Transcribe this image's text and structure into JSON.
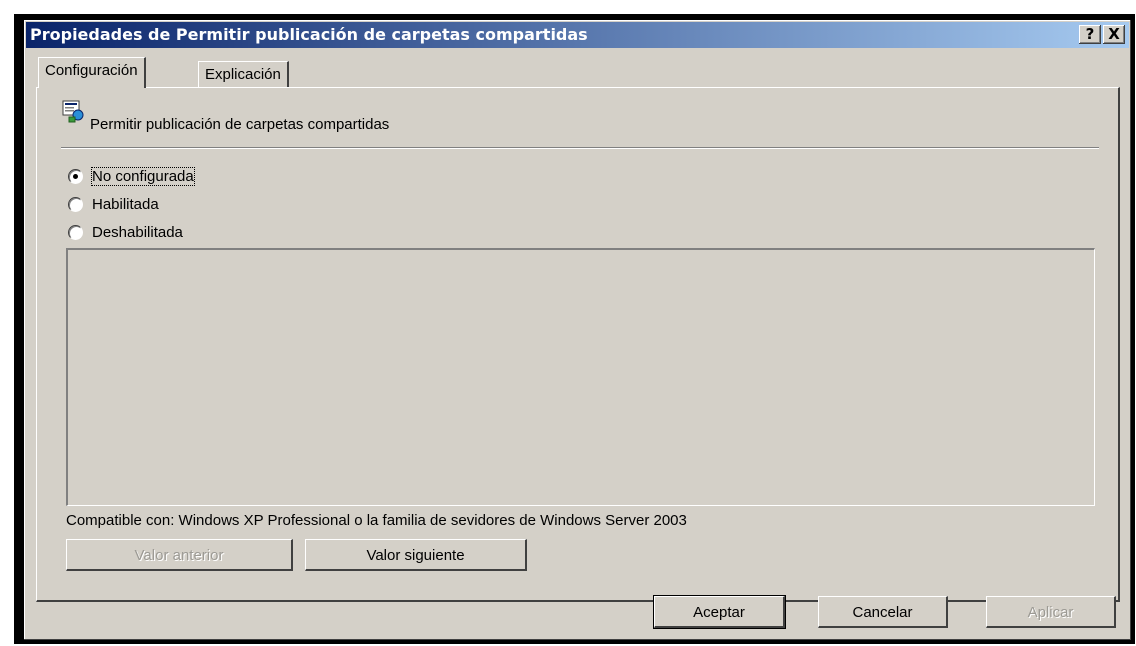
{
  "window": {
    "title": "Propiedades de Permitir publicación de carpetas compartidas",
    "help_button": "?",
    "close_button": "X"
  },
  "tabs": [
    {
      "label": "Configuración",
      "active": true
    },
    {
      "label": "Explicación",
      "active": false
    }
  ],
  "policy": {
    "icon": "policy-setting-icon",
    "title": "Permitir publicación de carpetas compartidas"
  },
  "options": [
    {
      "label": "No configurada",
      "selected": true
    },
    {
      "label": "Habilitada",
      "selected": false
    },
    {
      "label": "Deshabilitada",
      "selected": false
    }
  ],
  "compatibility": "Compatible con: Windows XP Professional o la familia de sevidores de Windows Server 2003",
  "nav_buttons": {
    "previous": "Valor anterior",
    "next": "Valor siguiente"
  },
  "footer_buttons": {
    "ok": "Aceptar",
    "cancel": "Cancelar",
    "apply": "Aplicar"
  }
}
